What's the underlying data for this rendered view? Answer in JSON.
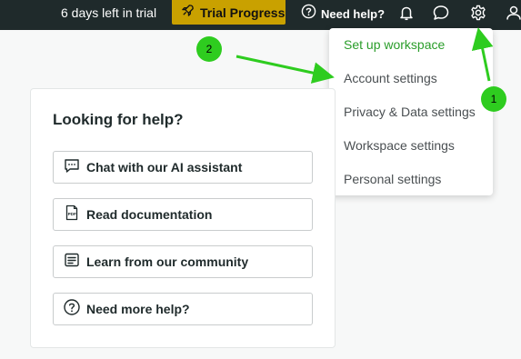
{
  "header": {
    "trial_text": "6 days left in trial",
    "trial_button_label": "Trial Progress",
    "help_label": "Need help?"
  },
  "settings_menu": {
    "items": [
      {
        "label": "Set up workspace",
        "active": true
      },
      {
        "label": "Account settings"
      },
      {
        "label": "Privacy & Data settings"
      },
      {
        "label": "Workspace settings"
      },
      {
        "label": "Personal settings"
      }
    ]
  },
  "help_panel": {
    "title": "Looking for help?",
    "items": [
      {
        "label": "Chat with our AI assistant",
        "icon": "chat-bubble-icon"
      },
      {
        "label": "Read documentation",
        "icon": "pdf-document-icon"
      },
      {
        "label": "Learn from our community",
        "icon": "community-list-icon"
      },
      {
        "label": "Need more help?",
        "icon": "question-circle-icon"
      }
    ]
  },
  "annotations": {
    "marker_1": "1",
    "marker_2": "2"
  },
  "colors": {
    "topbar": "#1f2a2b",
    "trial_button": "#c9a100",
    "active_menu_item": "#2a9d2a",
    "annotation": "#2ecc1f"
  }
}
